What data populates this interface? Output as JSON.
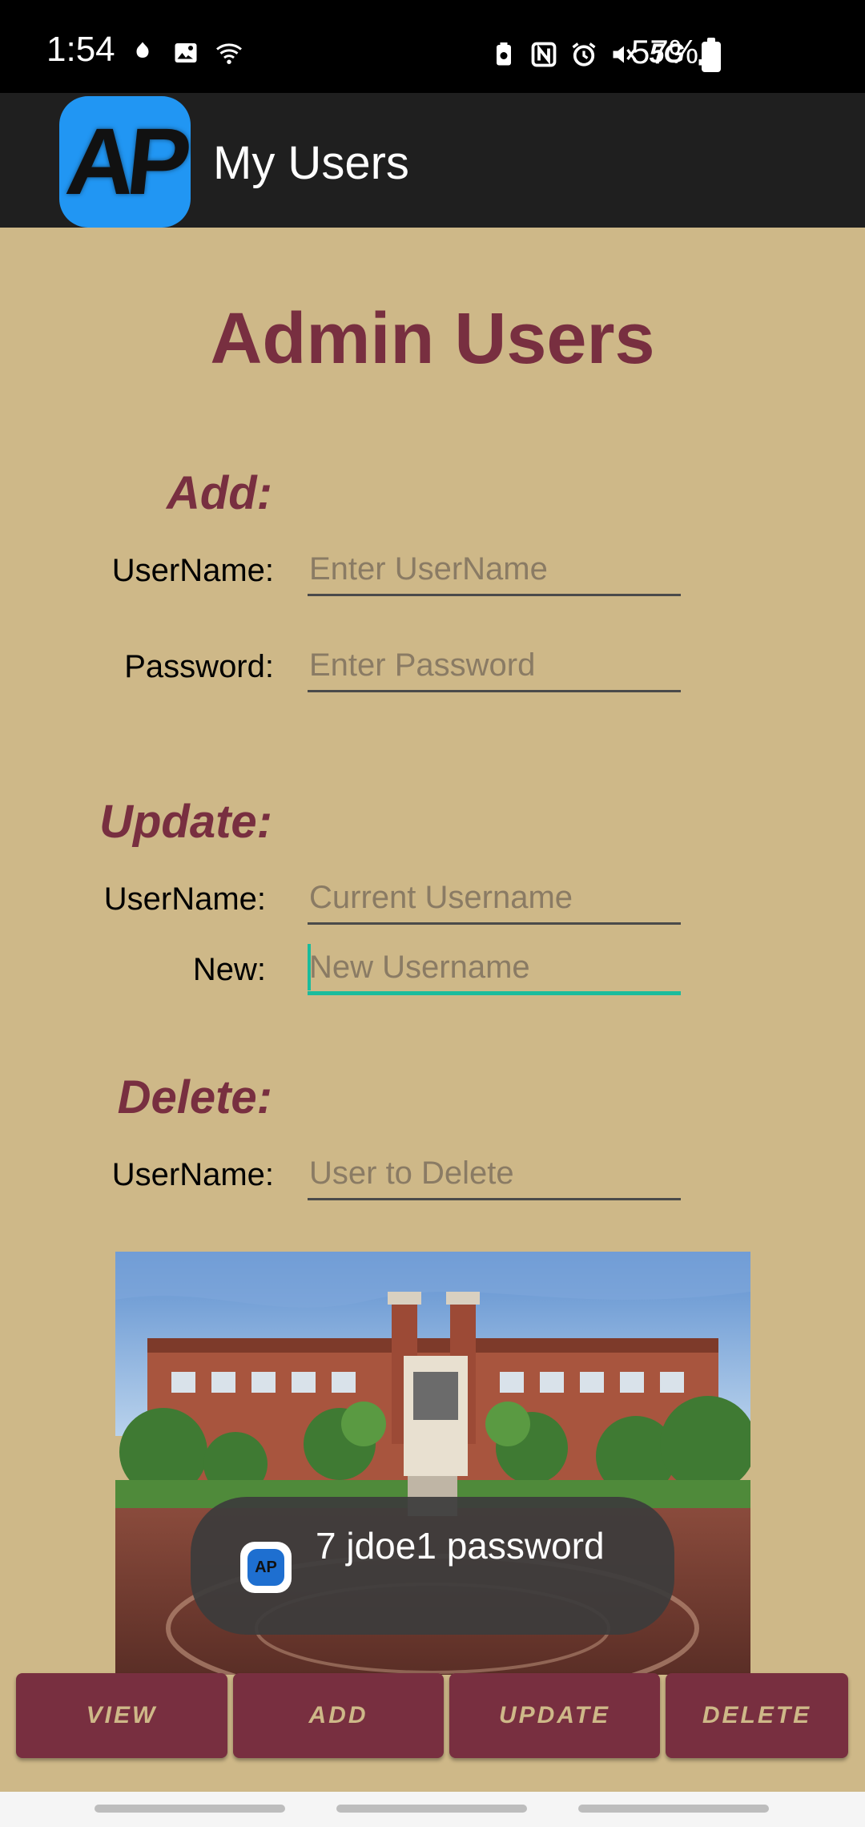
{
  "status_bar": {
    "time": "1:54",
    "battery": "57%",
    "network": "5G"
  },
  "app_bar": {
    "logo_text": "AP",
    "title": "My Users"
  },
  "page": {
    "title": "Admin Users"
  },
  "add_section": {
    "heading": "Add:",
    "username_label": "UserName:",
    "username_placeholder": "Enter UserName",
    "password_label": "Password:",
    "password_placeholder": "Enter Password"
  },
  "update_section": {
    "heading": "Update:",
    "username_label": "UserName:",
    "username_placeholder": "Current Username",
    "new_label": "New:",
    "new_placeholder": "New Username"
  },
  "delete_section": {
    "heading": "Delete:",
    "username_label": "UserName:",
    "username_placeholder": "User to Delete"
  },
  "toast": {
    "icon_text": "AP",
    "message": "7 jdoe1 password"
  },
  "buttons": {
    "view": "VIEW",
    "add": "ADD",
    "update": "UPDATE",
    "delete": "DELETE"
  },
  "colors": {
    "background": "#CEB888",
    "garnet": "#782F40",
    "accent": "#1ABC9C",
    "app_bar": "#1F1F1F"
  }
}
